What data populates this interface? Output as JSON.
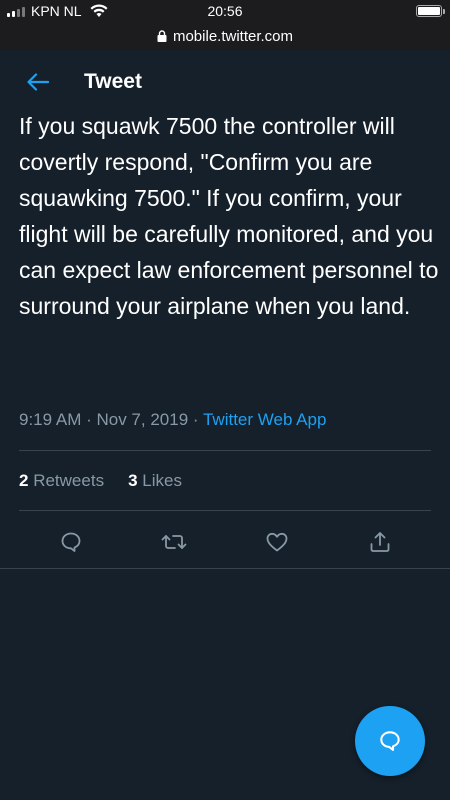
{
  "status_bar": {
    "carrier": "KPN NL",
    "time": "20:56"
  },
  "browser": {
    "url": "mobile.twitter.com"
  },
  "header": {
    "title": "Tweet",
    "back_icon": "arrow-left-icon"
  },
  "tweet": {
    "text": "If you squawk 7500 the controller will covertly respond, \"Confirm you are squawking 7500.\" If you confirm, your flight will be carefully monitored, and you can expect law enforcement personnel to surround your airplane when you land.",
    "timestamp": "9:19 AM · Nov 7, 2019 · ",
    "source": "Twitter Web App",
    "retweets_count": "2",
    "retweets_label": "Retweets",
    "likes_count": "3",
    "likes_label": "Likes"
  },
  "actions": {
    "reply_icon": "reply-icon",
    "retweet_icon": "retweet-icon",
    "like_icon": "heart-icon",
    "share_icon": "share-icon"
  },
  "fab": {
    "icon": "compose-message-icon"
  },
  "colors": {
    "background": "#15202b",
    "accent": "#1da1f2",
    "secondary_text": "#8899a6",
    "divider": "#38444d"
  }
}
